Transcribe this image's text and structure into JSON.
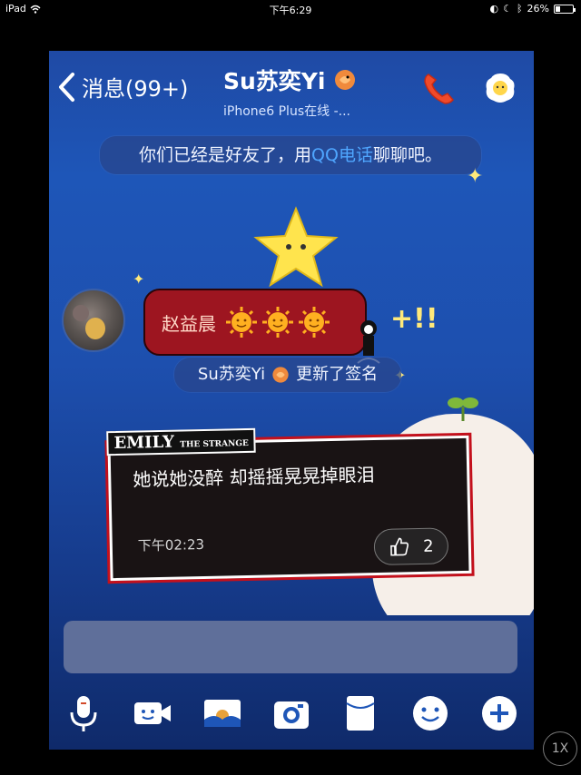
{
  "ipad_status": {
    "device": "iPad",
    "time": "下午6:29",
    "battery": "26%",
    "battery_fraction": 0.26
  },
  "nav": {
    "back_label": "消息(99+)",
    "title": "Su苏奕Yi",
    "subtitle": "iPhone6 Plus在线 -..."
  },
  "chat": {
    "friend_notice_pre": "你们已经是好友了，用",
    "friend_notice_link": "QQ电话",
    "friend_notice_post": "聊聊吧。",
    "incoming_name": "赵益晨",
    "signature_update_name": "Su苏奕Yi",
    "signature_update_text": "更新了签名",
    "card_brand": "EMILY",
    "card_brand_small": "THE STRANGE",
    "card_text": "她说她没醉 却摇摇晃晃掉眼泪",
    "card_time": "下午02:23",
    "like_count": "2"
  },
  "toolbar": {
    "icons": [
      "microphone-icon",
      "video-icon",
      "photo-icon",
      "camera-icon",
      "red-packet-icon",
      "emoji-icon",
      "plus-icon"
    ]
  },
  "zoom": {
    "label": "1X"
  },
  "colors": {
    "accent_link": "#4fa6ff",
    "bubble_red": "#9d1520",
    "bg_blue": "#1e56b8"
  }
}
